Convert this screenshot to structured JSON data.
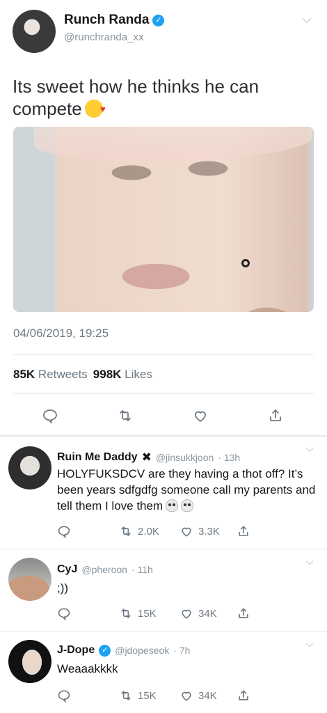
{
  "main_tweet": {
    "author_name": "Runch Randa",
    "handle": "@runchranda_xx",
    "text": "Its sweet how he thinks he can compete",
    "emoji": "face-blowing-kiss",
    "timestamp": "04/06/2019, 19:25",
    "retweets_count": "85K",
    "retweets_label": "Retweets",
    "likes_count": "998K",
    "likes_label": "Likes"
  },
  "replies": [
    {
      "author_name": "Ruin Me Daddy",
      "name_suffix": "✖",
      "handle": "@jinsukkjoon",
      "time": "· 13h",
      "text": "HOLYFUKSDCV are they having a thot off? It’s been years sdfgdfg someone call my parents and tell them I love them",
      "trailing_emoji": "skull-icon",
      "retweets": "2.0K",
      "likes": "3.3K"
    },
    {
      "author_name": "CyJ",
      "handle": "@pheroon",
      "time": "· 11h",
      "text": ";))",
      "retweets": "15K",
      "likes": "34K"
    },
    {
      "author_name": "J-Dope",
      "verified": true,
      "handle": "@jdopeseok",
      "time": "· 7h",
      "text": "Weaaakkkk",
      "retweets": "15K",
      "likes": "34K"
    }
  ],
  "colors": {
    "verified": "#1da1f2",
    "muted_text": "#6e7a84",
    "divider": "#e1e8ed"
  }
}
